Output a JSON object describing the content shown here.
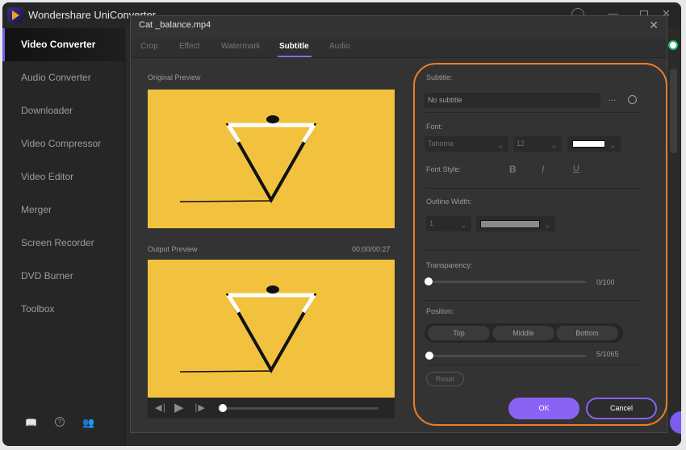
{
  "app": {
    "title": "Wondershare UniConverter",
    "window_controls": [
      "account-icon",
      "minimize-icon",
      "maximize-icon",
      "close-icon"
    ]
  },
  "sidebar": {
    "items": [
      {
        "label": "Video Converter",
        "active": true
      },
      {
        "label": "Audio Converter"
      },
      {
        "label": "Downloader"
      },
      {
        "label": "Video Compressor"
      },
      {
        "label": "Video Editor"
      },
      {
        "label": "Merger"
      },
      {
        "label": "Screen Recorder"
      },
      {
        "label": "DVD Burner"
      },
      {
        "label": "Toolbox"
      }
    ],
    "bottom_icons": [
      "book-icon",
      "help-icon",
      "user-icon"
    ]
  },
  "dialog": {
    "title": "Cat _balance.mp4",
    "tabs": [
      {
        "label": "Crop"
      },
      {
        "label": "Effect"
      },
      {
        "label": "Watermark"
      },
      {
        "label": "Subtitle",
        "active": true
      },
      {
        "label": "Audio"
      }
    ],
    "original_preview_label": "Original Preview",
    "output_preview_label": "Output Preview",
    "timecode": "00:00/00:27",
    "playback_progress": 0,
    "subtitle": {
      "section_label": "Subtitle:",
      "value": "No subtitle",
      "more_icon": "...",
      "search_icon": "search-icon"
    },
    "font": {
      "section_label": "Font:",
      "family": "Tahoma",
      "size": "12",
      "color": "#ffffff",
      "style_label": "Font Style:",
      "styles": [
        "B",
        "I",
        "U"
      ]
    },
    "outline": {
      "section_label": "Outline Width:",
      "width": "1",
      "color": "#8a8a8a"
    },
    "transparency": {
      "section_label": "Transparency:",
      "value": 0,
      "max": 100,
      "display": "0/100"
    },
    "position": {
      "section_label": "Position:",
      "options": [
        "Top",
        "Middle",
        "Bottom"
      ],
      "value": 5,
      "max": 1065,
      "display": "5/1065"
    },
    "buttons": {
      "reset": "Reset",
      "ok": "OK",
      "cancel": "Cancel"
    }
  },
  "colors": {
    "accent": "#8a63f5",
    "highlight": "#ef7d28",
    "preview_bg": "#f2c23e"
  }
}
